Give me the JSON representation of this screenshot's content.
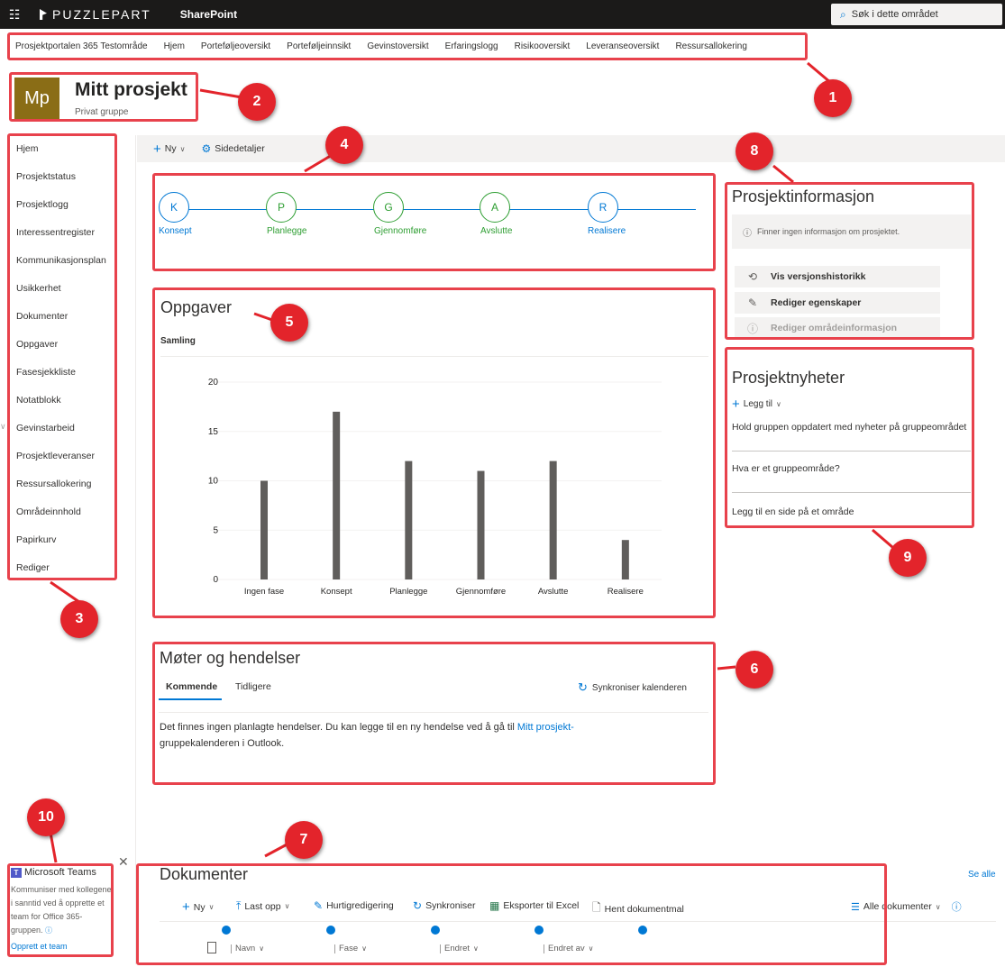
{
  "suitebar": {
    "brand": "PUZZLEPART",
    "product": "SharePoint",
    "search_placeholder": "Søk i dette området"
  },
  "hubnav": {
    "items": [
      "Prosjektportalen 365 Testområde",
      "Hjem",
      "Porteføljeoversikt",
      "Porteføljeinnsikt",
      "Gevinstoversikt",
      "Erfaringslogg",
      "Risikooversikt",
      "Leveranseoversikt",
      "Ressursallokering"
    ]
  },
  "site": {
    "logo_text": "Mp",
    "title": "Mitt prosjekt",
    "subtitle": "Privat gruppe",
    "logo_color": "#8a6d16"
  },
  "leftnav": {
    "items": [
      "Hjem",
      "Prosjektstatus",
      "Prosjektlogg",
      "Interessentregister",
      "Kommunikasjonsplan",
      "Usikkerhet",
      "Dokumenter",
      "Oppgaver",
      "Fasesjekkliste",
      "Notatblokk",
      "Gevinstarbeid",
      "Prosjektleveranser",
      "Ressursallokering",
      "Områdeinnhold",
      "Papirkurv",
      "Rediger"
    ]
  },
  "commandbar": {
    "new_label": "Ny",
    "page_details_label": "Sidedetaljer"
  },
  "phases": [
    {
      "letter": "K",
      "label": "Konsept",
      "color": "blue"
    },
    {
      "letter": "P",
      "label": "Planlegge",
      "color": "green"
    },
    {
      "letter": "G",
      "label": "Gjennomføre",
      "color": "green"
    },
    {
      "letter": "A",
      "label": "Avslutte",
      "color": "green"
    },
    {
      "letter": "R",
      "label": "Realisere",
      "color": "blue"
    }
  ],
  "oppgaver": {
    "title": "Oppgaver",
    "subtitle": "Samling"
  },
  "chart_data": {
    "type": "bar",
    "categories": [
      "Ingen fase",
      "Konsept",
      "Planlegge",
      "Gjennomføre",
      "Avslutte",
      "Realisere"
    ],
    "values": [
      10,
      17,
      12,
      11,
      12,
      4
    ],
    "yticks": [
      0,
      5,
      10,
      15,
      20
    ],
    "ylim": [
      0,
      20
    ],
    "bar_color": "#605e5c",
    "grid": true
  },
  "moter": {
    "title": "Møter og hendelser",
    "tab_upcoming": "Kommende",
    "tab_past": "Tidligere",
    "sync_label": "Synkroniser kalenderen",
    "empty_text_before": "Det finnes ingen planlagte hendelser. Du kan legge til en ny hendelse ved å gå til ",
    "empty_link": "Mitt prosjekt-",
    "empty_text_after": "gruppekalenderen i Outlook."
  },
  "prosjektinfo": {
    "title": "Prosjektinformasjon",
    "empty_text": "Finner ingen informasjon om prosjektet.",
    "btn_history": "Vis versjonshistorikk",
    "btn_edit_props": "Rediger egenskaper",
    "btn_edit_site": "Rediger områdeinformasjon"
  },
  "prosjektnyheter": {
    "title": "Prosjektnyheter",
    "add_label": "Legg til",
    "items": [
      "Hold gruppen oppdatert med nyheter på gruppeområdet",
      "Hva er et gruppeområde?",
      "Legg til en side på et område"
    ]
  },
  "teams": {
    "title": "Microsoft Teams",
    "description": "Kommuniser med kollegene i sanntid ved å opprette et team for Office 365-gruppen.",
    "link": "Opprett et team"
  },
  "dokumenter": {
    "title": "Dokumenter",
    "see_all": "Se alle",
    "cmd_new": "Ny",
    "cmd_upload": "Last opp",
    "cmd_quickedit": "Hurtigredigering",
    "cmd_sync": "Synkroniser",
    "cmd_export": "Eksporter til Excel",
    "cmd_template": "Hent dokumentmal",
    "view_label": "Alle dokumenter",
    "columns": [
      "Navn",
      "Fase",
      "Endret",
      "Endret av"
    ]
  },
  "annotations": [
    "1",
    "2",
    "3",
    "4",
    "5",
    "6",
    "7",
    "8",
    "9",
    "10"
  ],
  "colors": {
    "accent": "#0078d4",
    "phase_green": "#2e9e32",
    "annotation_red": "#e3242b",
    "suitebar": "#1b1a19"
  }
}
